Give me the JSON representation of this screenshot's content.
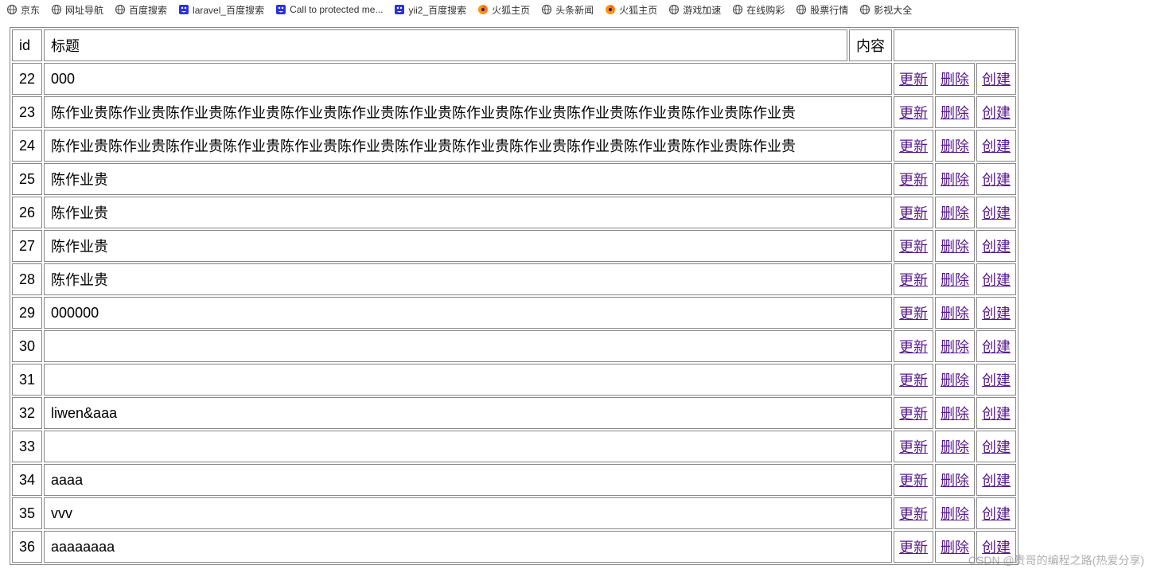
{
  "bookmarks": [
    {
      "label": "京东",
      "icon": "globe"
    },
    {
      "label": "网址导航",
      "icon": "globe"
    },
    {
      "label": "百度搜索",
      "icon": "globe"
    },
    {
      "label": "laravel_百度搜索",
      "icon": "baidu"
    },
    {
      "label": "Call to protected me...",
      "icon": "baidu"
    },
    {
      "label": "yii2_百度搜索",
      "icon": "baidu"
    },
    {
      "label": "火狐主页",
      "icon": "firefox"
    },
    {
      "label": "头条新闻",
      "icon": "globe"
    },
    {
      "label": "火狐主页",
      "icon": "firefox"
    },
    {
      "label": "游戏加速",
      "icon": "globe"
    },
    {
      "label": "在线购彩",
      "icon": "globe"
    },
    {
      "label": "股票行情",
      "icon": "globe"
    },
    {
      "label": "影视大全",
      "icon": "globe"
    }
  ],
  "table": {
    "headers": {
      "id": "id",
      "title": "标题",
      "content": "内容"
    },
    "rows": [
      {
        "id": "22",
        "title": "000"
      },
      {
        "id": "23",
        "title": "陈作业贵陈作业贵陈作业贵陈作业贵陈作业贵陈作业贵陈作业贵陈作业贵陈作业贵陈作业贵陈作业贵陈作业贵陈作业贵"
      },
      {
        "id": "24",
        "title": "陈作业贵陈作业贵陈作业贵陈作业贵陈作业贵陈作业贵陈作业贵陈作业贵陈作业贵陈作业贵陈作业贵陈作业贵陈作业贵"
      },
      {
        "id": "25",
        "title": "陈作业贵"
      },
      {
        "id": "26",
        "title": "陈作业贵"
      },
      {
        "id": "27",
        "title": "陈作业贵"
      },
      {
        "id": "28",
        "title": "陈作业贵"
      },
      {
        "id": "29",
        "title": "000000"
      },
      {
        "id": "30",
        "title": ""
      },
      {
        "id": "31",
        "title": ""
      },
      {
        "id": "32",
        "title": "liwen&aaa"
      },
      {
        "id": "33",
        "title": ""
      },
      {
        "id": "34",
        "title": "aaaa"
      },
      {
        "id": "35",
        "title": "vvv"
      },
      {
        "id": "36",
        "title": "aaaaaaaa"
      }
    ],
    "actions": {
      "update": "更新",
      "delete": "删除",
      "create": "创建"
    }
  },
  "watermark": "CSDN @贵哥的编程之路(热爱分享)"
}
